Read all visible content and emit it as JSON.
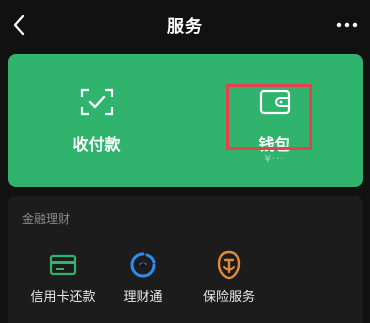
{
  "header": {
    "title": "服务",
    "back_icon": "chevron-left-icon",
    "more_icon": "more-dots-icon"
  },
  "green_card": {
    "color": "#2fb36d",
    "items": [
      {
        "label": "收付款",
        "icon": "scan-check-icon"
      },
      {
        "label": "钱包",
        "icon": "wallet-icon",
        "sub": "¥···"
      }
    ],
    "highlight_color": "#e8414e"
  },
  "finance": {
    "title": "金融理财",
    "items": [
      {
        "label": "信用卡还款",
        "icon": "credit-card-icon",
        "color": "#2fb36d"
      },
      {
        "label": "理财通",
        "icon": "wealth-icon",
        "color": "#2d8cf0"
      },
      {
        "label": "保险服务",
        "icon": "insurance-icon",
        "color": "#e08a3c"
      }
    ]
  }
}
